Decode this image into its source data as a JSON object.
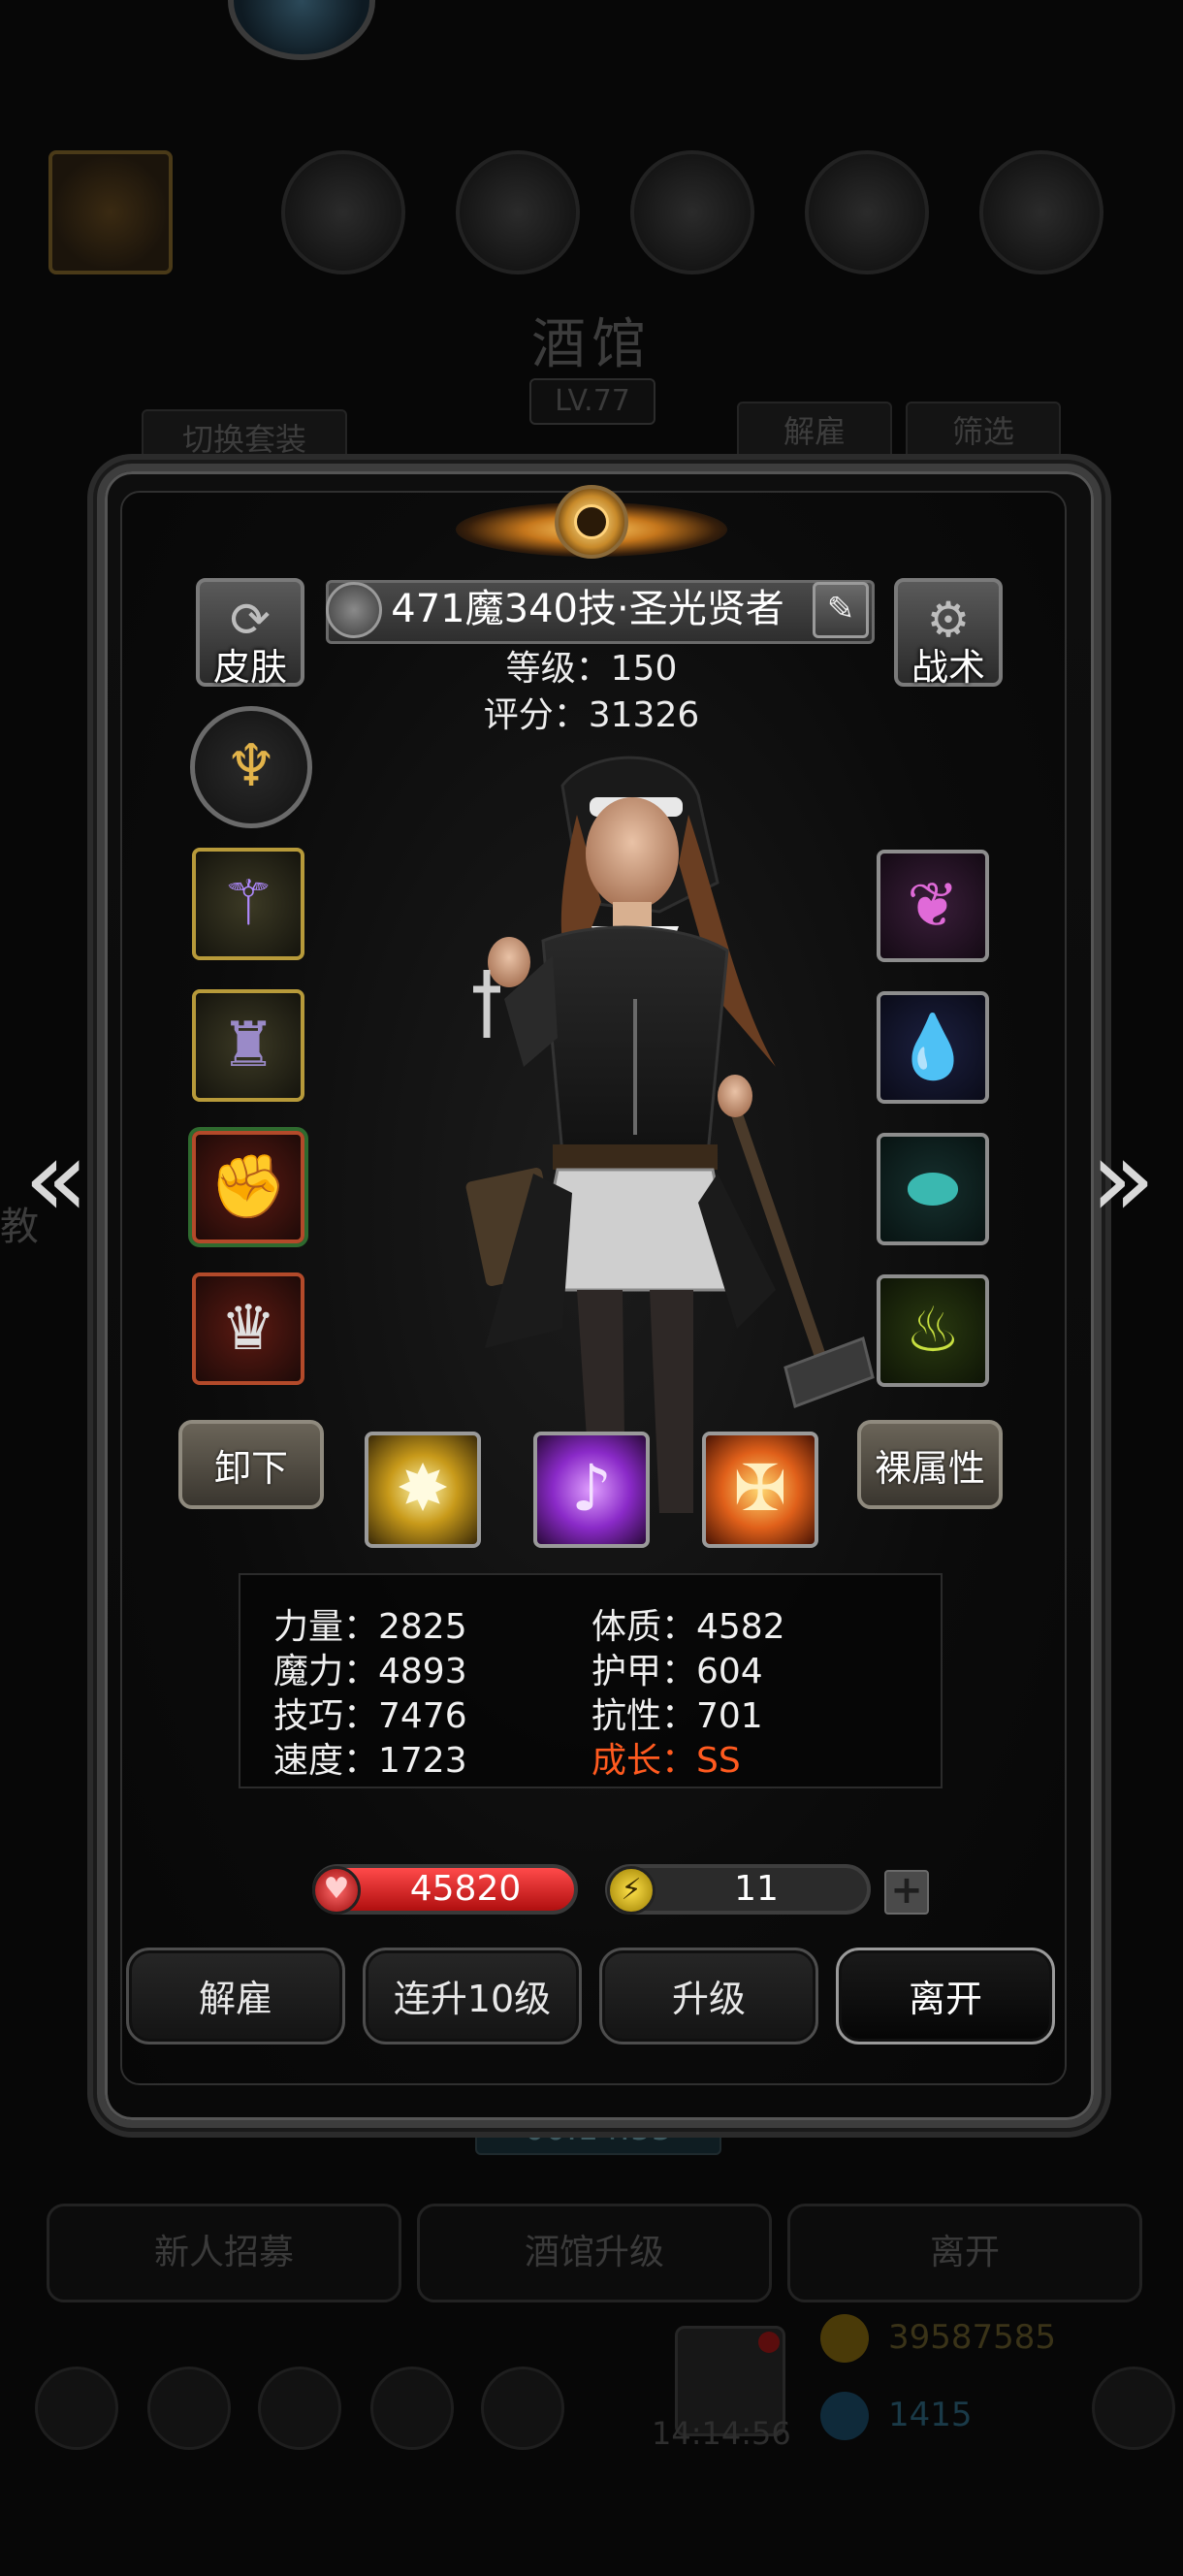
{
  "background": {
    "title": "酒馆",
    "level": "LV.77",
    "switch_outfit": "切换套装",
    "dismiss": "解雇",
    "filter": "筛选",
    "timer": "00:14:55",
    "side_char": "教",
    "bottom_buttons": [
      "新人招募",
      "酒馆升级",
      "离开"
    ],
    "clock": "14:14:56",
    "gold": "39587585",
    "gems": "1415"
  },
  "hero": {
    "name": "471魔340技·圣光贤者",
    "level_line": "等级：150",
    "score_line": "评分：31326",
    "skin_label": "皮肤",
    "tactics_label": "战术"
  },
  "actions": {
    "unequip": "卸下",
    "naked_stats": "裸属性"
  },
  "stats": {
    "strength": "力量：2825",
    "magic": "魔力：4893",
    "skill": "技巧：7476",
    "speed": "速度：1723",
    "constitution": "体质：4582",
    "armor": "护甲：604",
    "resistance": "抗性：701",
    "growth_label": "成长：",
    "growth_value": "SS"
  },
  "bars": {
    "hp": "45820",
    "energy": "11",
    "energy_fill": 0.1,
    "plus": "+"
  },
  "buttons": {
    "dismiss": "解雇",
    "level10": "连升10级",
    "upgrade": "升级",
    "leave": "离开"
  },
  "colors": {
    "growth": "#ff5a1f",
    "hp": "#d81a1a",
    "energy": "#ffd800"
  }
}
